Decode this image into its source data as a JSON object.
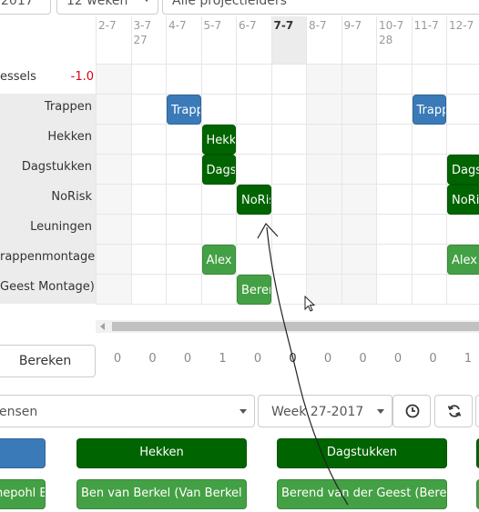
{
  "top": {
    "year_value": "2017",
    "weeks_value": "12 weken",
    "leaders_value": "Alle projectleiders"
  },
  "days": [
    {
      "label": "2-7",
      "sub": "",
      "shade": true,
      "today": false
    },
    {
      "label": "3-7",
      "sub": "27",
      "shade": false,
      "today": false
    },
    {
      "label": "4-7",
      "sub": "",
      "shade": false,
      "today": false
    },
    {
      "label": "5-7",
      "sub": "",
      "shade": false,
      "today": false
    },
    {
      "label": "6-7",
      "sub": "",
      "shade": false,
      "today": false
    },
    {
      "label": "7-7",
      "sub": "",
      "shade": false,
      "today": true
    },
    {
      "label": "8-7",
      "sub": "",
      "shade": true,
      "today": false
    },
    {
      "label": "9-7",
      "sub": "",
      "shade": true,
      "today": false
    },
    {
      "label": "10-7",
      "sub": "28",
      "shade": false,
      "today": false
    },
    {
      "label": "11-7",
      "sub": "",
      "shade": false,
      "today": false
    },
    {
      "label": "12-7",
      "sub": "",
      "shade": false,
      "today": false
    }
  ],
  "rows": [
    {
      "label": "essels",
      "value": "-1.0"
    },
    {
      "label": "Trappen"
    },
    {
      "label": "Hekken"
    },
    {
      "label": "Dagstukken"
    },
    {
      "label": "NoRisk"
    },
    {
      "label": "Leuningen"
    },
    {
      "label": "rappenmontage)"
    },
    {
      "label": "Geest Montage)"
    }
  ],
  "tasks": [
    {
      "text": "Trappen",
      "color": "blue"
    },
    {
      "text": "Trappen",
      "color": "blue"
    },
    {
      "text": "Hekken",
      "color": "dark"
    },
    {
      "text": "Dagstukken",
      "color": "dark"
    },
    {
      "text": "Dagstukken",
      "color": "dark"
    },
    {
      "text": "NoRisk",
      "color": "dark"
    },
    {
      "text": "NoRisk",
      "color": "dark"
    },
    {
      "text": "Alex S",
      "color": "mid"
    },
    {
      "text": "Alex S",
      "color": "mid"
    },
    {
      "text": "Berend",
      "color": "mid"
    }
  ],
  "bereken_label": "Bereken",
  "counts": [
    "0",
    "0",
    "0",
    "1",
    "0",
    "0",
    "0",
    "0",
    "0",
    "0",
    "1"
  ],
  "filter": {
    "type_value": "ensen",
    "week_value": "Week 27-2017"
  },
  "icons": [
    "clock-icon",
    "refresh-icon"
  ],
  "legend": {
    "row1": [
      "",
      "Hekken",
      "Dagstukken",
      ""
    ],
    "row2": [
      "nepohl B",
      "Ben van Berkel (Van Berkel P",
      "Berend van der Geest (Beren",
      ""
    ]
  },
  "colors": {
    "blue": "#3a7ab8",
    "dark": "#006400",
    "mid": "#44a044",
    "negative": "#d9001b"
  }
}
